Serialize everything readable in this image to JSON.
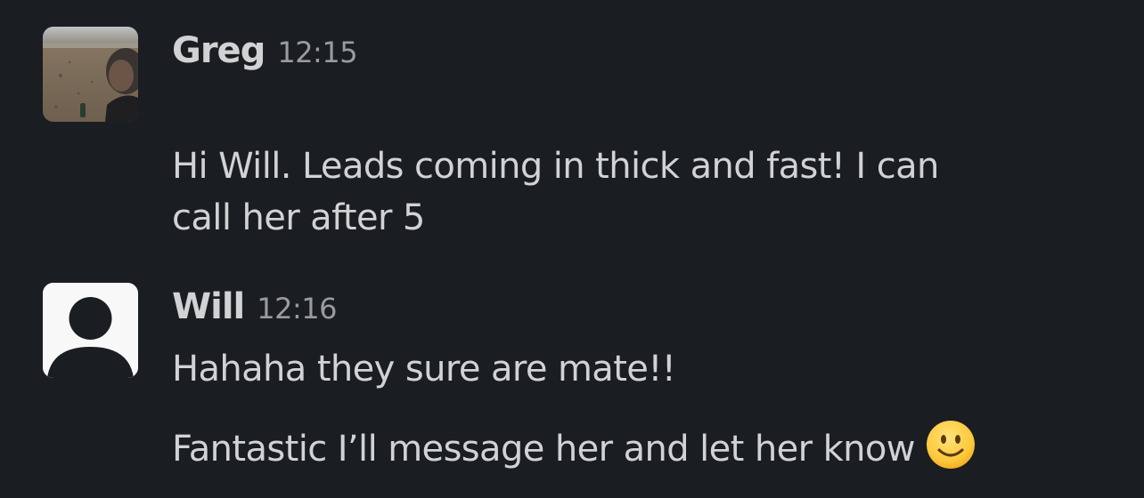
{
  "messages": [
    {
      "sender": "Greg",
      "time": "12:15",
      "lines": [
        "Hi Will. Leads coming in thick and fast! I can",
        "call her after 5"
      ]
    },
    {
      "sender": "Will",
      "time": "12:16",
      "lines": [
        "Hahaha they sure are mate!!",
        "Fantastic I’ll message her and let her know"
      ],
      "emoji": "slightly-smiling-face-icon"
    }
  ],
  "colors": {
    "background": "#1a1d21",
    "text": "#d1d2d3",
    "timestamp": "#9a9b9d"
  }
}
